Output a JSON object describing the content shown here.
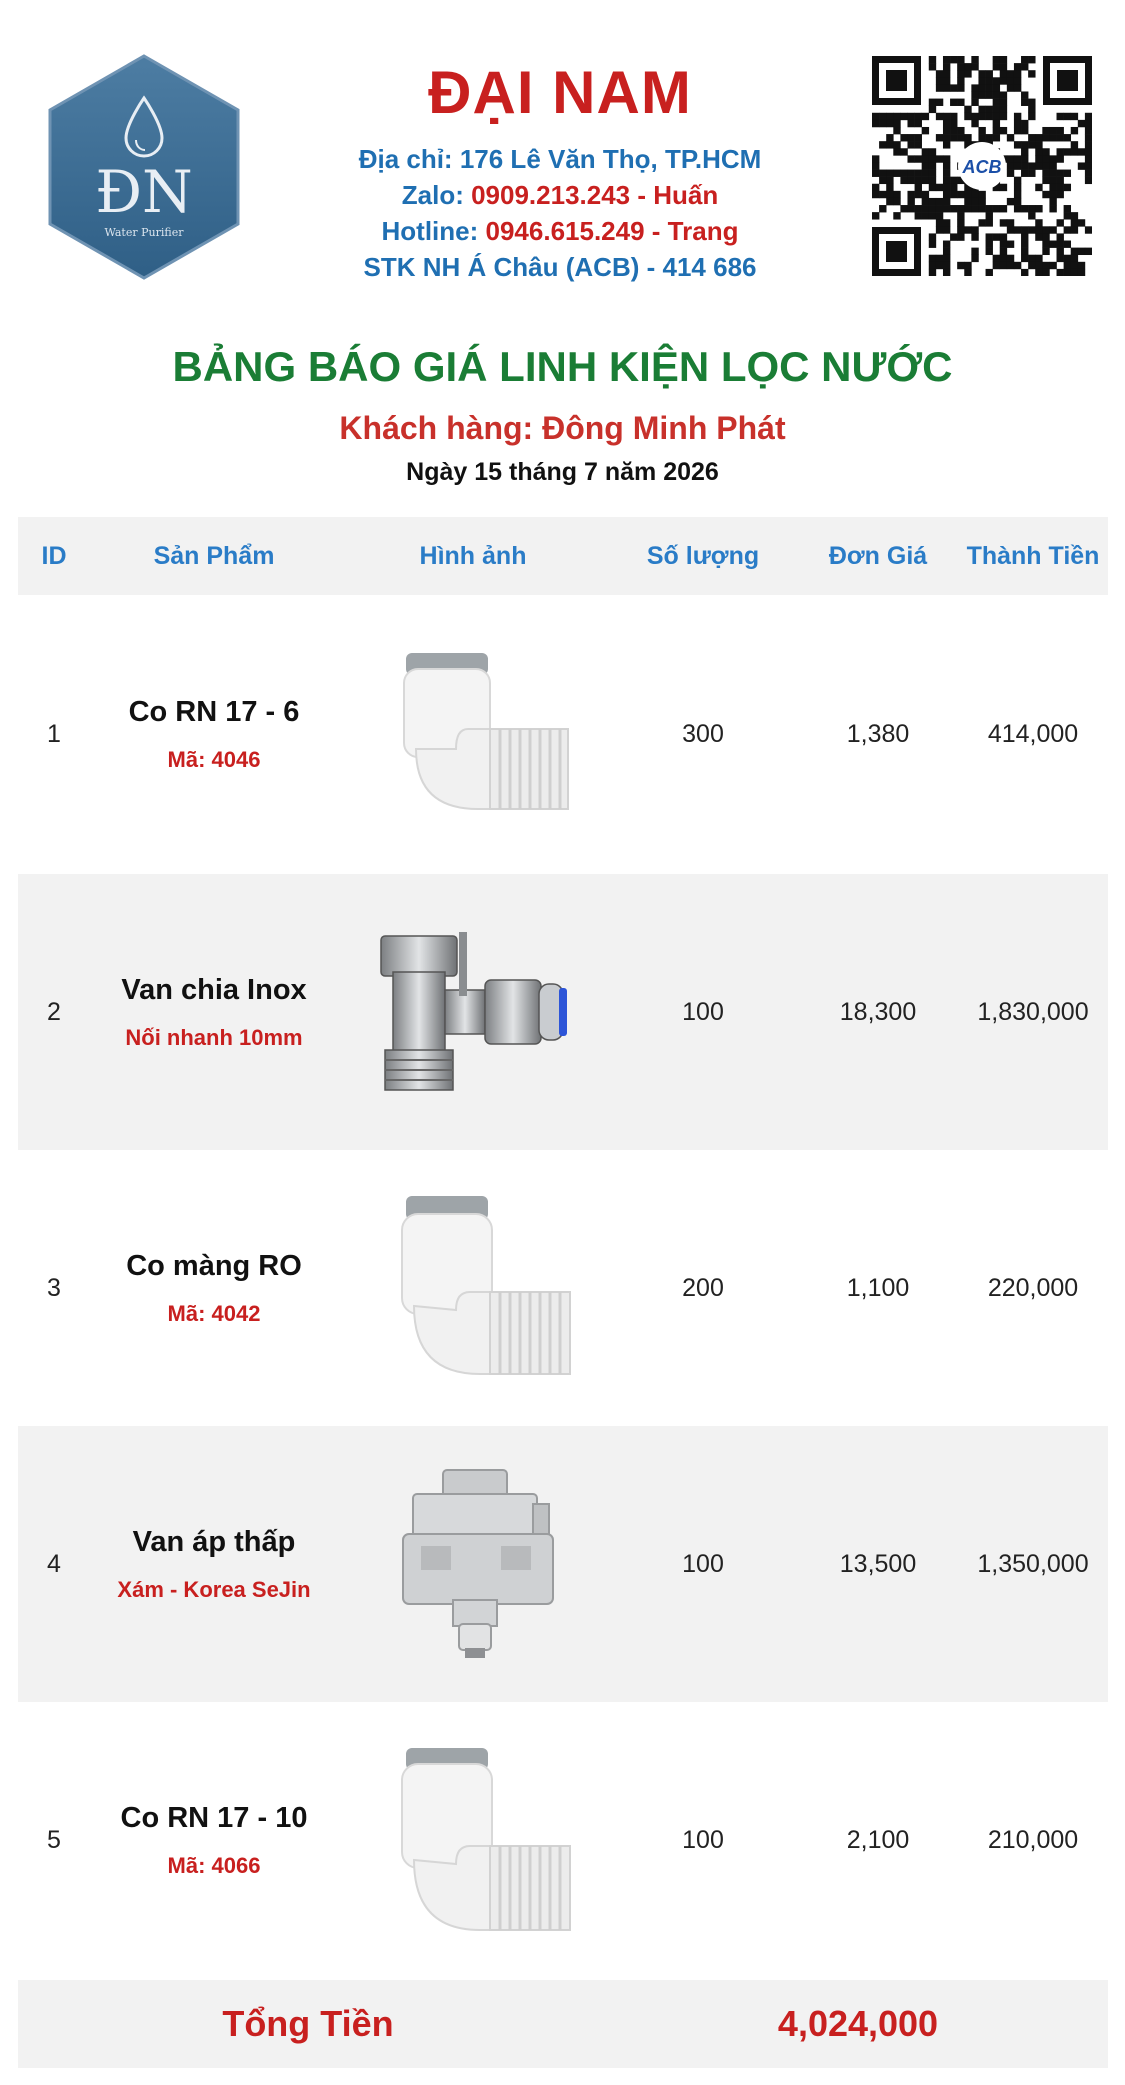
{
  "header": {
    "logo_text": "ĐN",
    "logo_subtext": "Water Purifier",
    "brand": "ĐẠI NAM",
    "address_label": "Địa chỉ: ",
    "address": "176 Lê Văn Thọ, TP.HCM",
    "zalo_label": "Zalo: ",
    "zalo": "0909.213.243 - Huấn",
    "hotline_label": "Hotline: ",
    "hotline": "0946.615.249 - Trang",
    "bank_label": "STK NH Á Châu (ACB) - ",
    "bank_account": "414 686",
    "qr_badge": "ACB"
  },
  "doc": {
    "title": "BẢNG BÁO GIÁ LINH KIỆN LỌC NƯỚC",
    "customer": "Khách hàng: Đông Minh Phát",
    "date": "Ngày 15 tháng 7 năm 2026"
  },
  "table": {
    "headers": {
      "id": "ID",
      "product": "Sản Phẩm",
      "image": "Hình ảnh",
      "qty": "Số lượng",
      "price": "Đơn Giá",
      "total": "Thành Tiền"
    },
    "rows": [
      {
        "id": "1",
        "name": "Co RN 17 - 6",
        "sub": "Mã: 4046",
        "qty": "300",
        "price": "1,380",
        "total": "414,000",
        "image": "white-elbow-fitting"
      },
      {
        "id": "2",
        "name": "Van chia Inox",
        "sub": "Nối nhanh 10mm",
        "qty": "100",
        "price": "18,300",
        "total": "1,830,000",
        "image": "steel-tee-valve"
      },
      {
        "id": "3",
        "name": "Co màng RO",
        "sub": "Mã: 4042",
        "qty": "200",
        "price": "1,100",
        "total": "220,000",
        "image": "white-elbow-fitting"
      },
      {
        "id": "4",
        "name": "Van áp thấp",
        "sub": "Xám - Korea SeJin",
        "qty": "100",
        "price": "13,500",
        "total": "1,350,000",
        "image": "grey-pressure-switch"
      },
      {
        "id": "5",
        "name": "Co RN 17 - 10",
        "sub": "Mã: 4066",
        "qty": "100",
        "price": "2,100",
        "total": "210,000",
        "image": "white-elbow-fitting"
      }
    ]
  },
  "footer": {
    "total_label": "Tổng Tiền",
    "total_value": "4,024,000"
  },
  "colors": {
    "brand_red": "#c8201f",
    "info_blue": "#1f6fb2",
    "title_green": "#1a7d35",
    "header_blue": "#2a7cc7",
    "row_shade": "#f2f2f2",
    "logo_blue": "#3e6f95"
  }
}
